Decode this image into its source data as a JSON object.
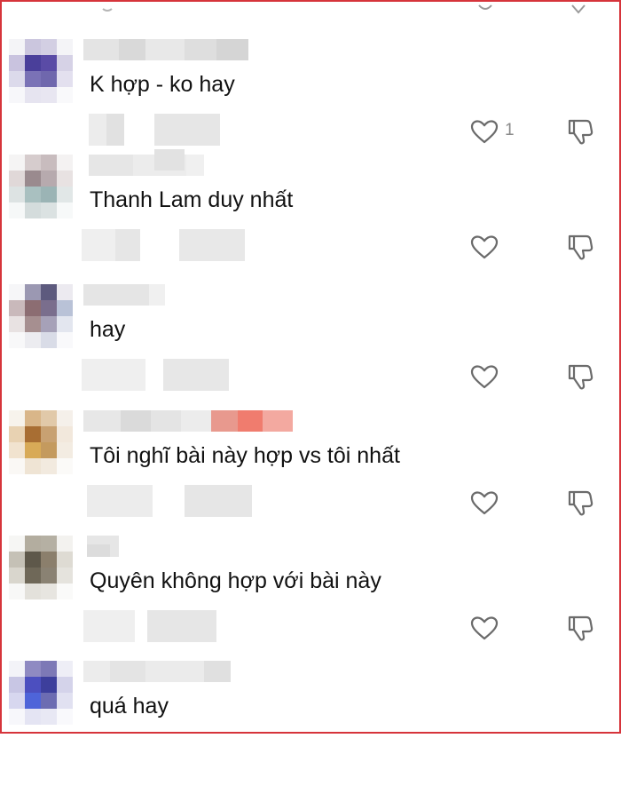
{
  "colors": {
    "frame_border": "#d6343b",
    "text": "#111111",
    "like_count": "#8a8a8a",
    "icon_stroke": "#6b6b6b",
    "blur_light": "#e9e9e9",
    "blur_mid": "#dcdcdc"
  },
  "icons": {
    "like": "heart-outline",
    "dislike": "thumbs-down-outline"
  },
  "comments": [
    {
      "text": "K hợp - ko hay",
      "like_count": "1"
    },
    {
      "text": "Thanh Lam duy nhất",
      "like_count": ""
    },
    {
      "text": "hay",
      "like_count": ""
    },
    {
      "text": "Tôi nghĩ bài này hợp vs tôi nhất",
      "like_count": ""
    },
    {
      "text": "Quyên không hợp với bài này",
      "like_count": ""
    },
    {
      "text": "quá hay",
      "like_count": ""
    }
  ]
}
